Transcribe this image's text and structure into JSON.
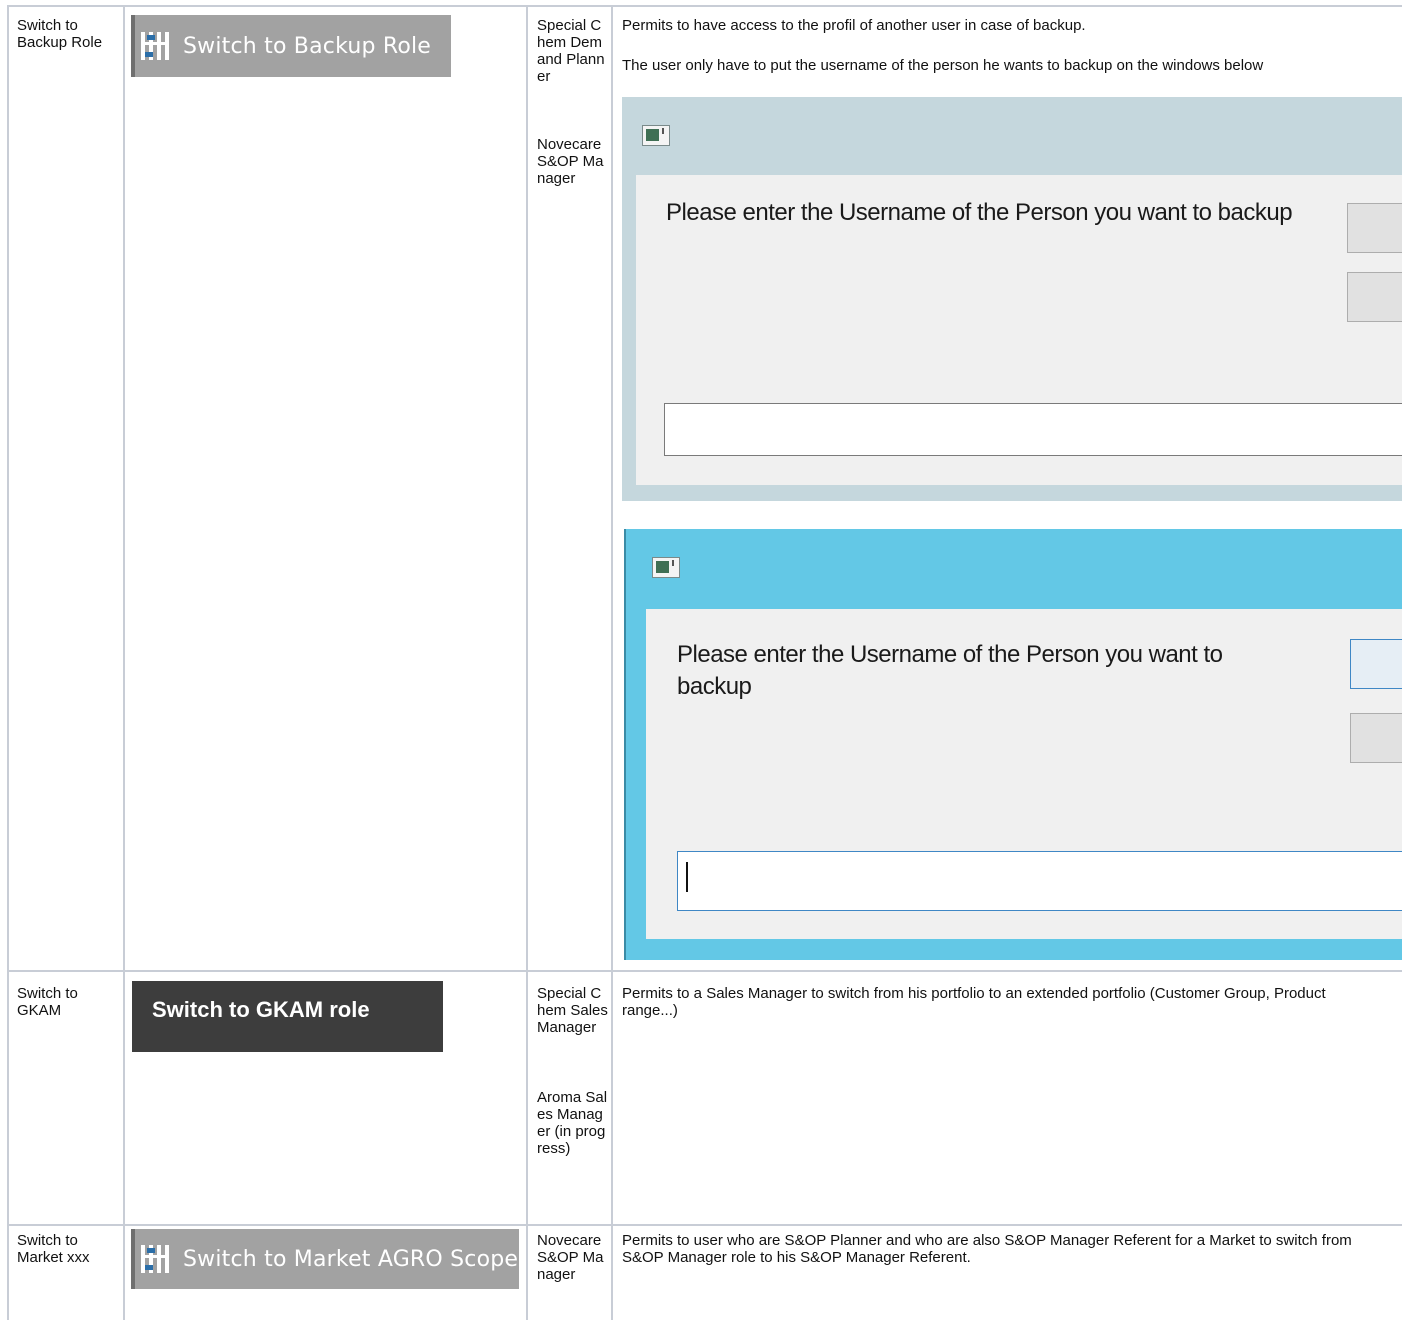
{
  "rows": [
    {
      "feature": "Switch to Backup Role",
      "button_label": "Switch to Backup Role",
      "roles": [
        "Special Chem Demand Planner",
        "Novecare S&OP Manager"
      ],
      "description": [
        "Permits to have access to the profil of another user in case of backup.",
        "The user only have to put the username of the person he wants to backup on the windows below"
      ],
      "dialogs": [
        {
          "prompt": "Please enter the Username of the Person you want to backup",
          "input_value": ""
        },
        {
          "prompt": "Please enter the Username of the Person you want to backup",
          "input_value": ""
        }
      ]
    },
    {
      "feature": "Switch to GKAM",
      "button_label": "Switch to GKAM role",
      "roles": [
        "Special Chem Sales Manager",
        "Aroma Sales Manager (in progress)"
      ],
      "description": "Permits to a Sales Manager to switch from his portfolio to an extended portfolio (Customer Group, Product range...)"
    },
    {
      "feature": "Switch to Market xxx",
      "button_label": "Switch to Market AGRO Scope",
      "roles": [
        "Novecare S&OP Manager"
      ],
      "description": "Permits to user who are S&OP Planner and who are also S&OP Manager Referent for a Market to switch from S&OP Manager role to his S&OP Manager Referent."
    }
  ],
  "colors": {
    "grid": "#c8cdd6",
    "ribbon_button": "#a2a2a2",
    "dark_button": "#3d3d3d",
    "dialog1_frame": "#c5d7dd",
    "dialog2_frame": "#63c8e6"
  },
  "icons": [
    "org-chart-icon",
    "window-app-icon"
  ]
}
